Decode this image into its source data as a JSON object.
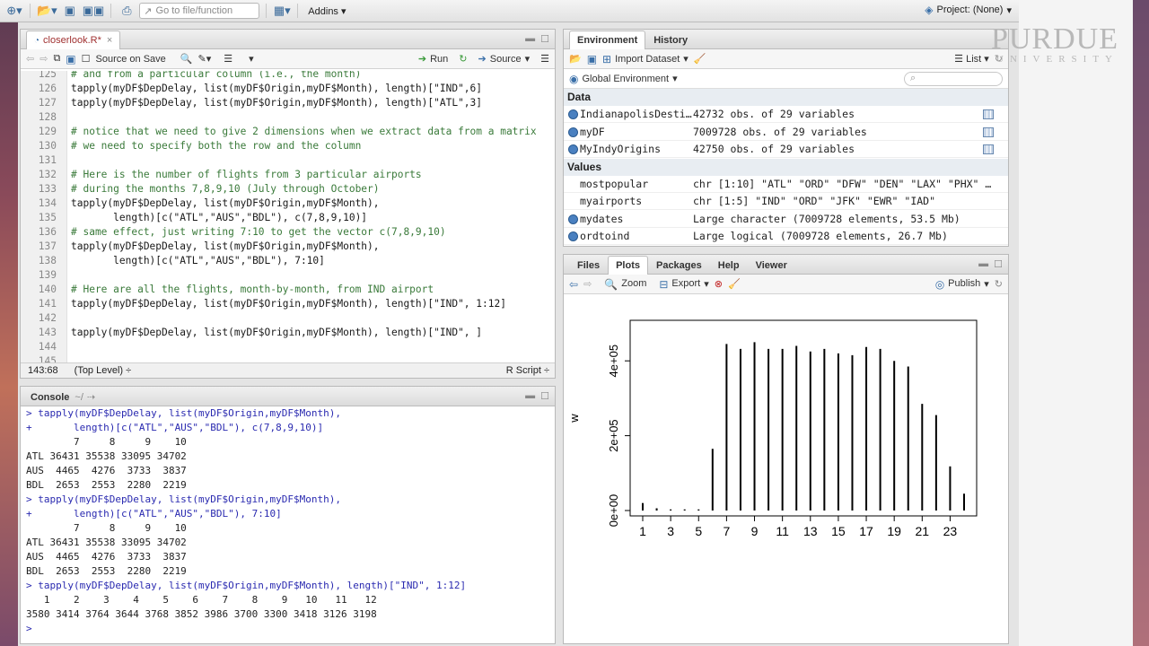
{
  "toolbar": {
    "goto_placeholder": "Go to file/function",
    "addins": "Addins",
    "project": "Project: (None)"
  },
  "branding": {
    "name": "PURDUE",
    "sub": "UNIVERSITY"
  },
  "editor": {
    "tab": "closerlook.R*",
    "source_on_save": "Source on Save",
    "run": "Run",
    "source": "Source",
    "lines": [
      {
        "n": "125",
        "t": "# and from a particular column (i.e., the month)",
        "c": true
      },
      {
        "n": "126",
        "t": "tapply(myDF$DepDelay, list(myDF$Origin,myDF$Month), length)[\"IND\",6]"
      },
      {
        "n": "127",
        "t": "tapply(myDF$DepDelay, list(myDF$Origin,myDF$Month), length)[\"ATL\",3]"
      },
      {
        "n": "128",
        "t": ""
      },
      {
        "n": "129",
        "t": "# notice that we need to give 2 dimensions when we extract data from a matrix",
        "c": true
      },
      {
        "n": "130",
        "t": "# we need to specify both the row and the column",
        "c": true
      },
      {
        "n": "131",
        "t": ""
      },
      {
        "n": "132",
        "t": "# Here is the number of flights from 3 particular airports",
        "c": true
      },
      {
        "n": "133",
        "t": "# during the months 7,8,9,10 (July through October)",
        "c": true
      },
      {
        "n": "134",
        "t": "tapply(myDF$DepDelay, list(myDF$Origin,myDF$Month),"
      },
      {
        "n": "135",
        "t": "       length)[c(\"ATL\",\"AUS\",\"BDL\"), c(7,8,9,10)]"
      },
      {
        "n": "136",
        "t": "# same effect, just writing 7:10 to get the vector c(7,8,9,10)",
        "c": true
      },
      {
        "n": "137",
        "t": "tapply(myDF$DepDelay, list(myDF$Origin,myDF$Month),"
      },
      {
        "n": "138",
        "t": "       length)[c(\"ATL\",\"AUS\",\"BDL\"), 7:10]"
      },
      {
        "n": "139",
        "t": ""
      },
      {
        "n": "140",
        "t": "# Here are all the flights, month-by-month, from IND airport",
        "c": true
      },
      {
        "n": "141",
        "t": "tapply(myDF$DepDelay, list(myDF$Origin,myDF$Month), length)[\"IND\", 1:12]"
      },
      {
        "n": "142",
        "t": ""
      },
      {
        "n": "143",
        "t": "tapply(myDF$DepDelay, list(myDF$Origin,myDF$Month), length)[\"IND\", ]"
      },
      {
        "n": "144",
        "t": ""
      },
      {
        "n": "145",
        "t": ""
      }
    ],
    "status_pos": "143:68",
    "status_scope": "(Top Level) ÷",
    "status_type": "R Script ÷"
  },
  "console": {
    "tab": "Console",
    "path": "~/",
    "lines": [
      {
        "t": "> tapply(myDF$DepDelay, list(myDF$Origin,myDF$Month),",
        "cmd": true
      },
      {
        "t": "+       length)[c(\"ATL\",\"AUS\",\"BDL\"), c(7,8,9,10)]",
        "cmd": true
      },
      {
        "t": "        7     8     9    10"
      },
      {
        "t": "ATL 36431 35538 33095 34702"
      },
      {
        "t": "AUS  4465  4276  3733  3837"
      },
      {
        "t": "BDL  2653  2553  2280  2219"
      },
      {
        "t": "> tapply(myDF$DepDelay, list(myDF$Origin,myDF$Month),",
        "cmd": true
      },
      {
        "t": "+       length)[c(\"ATL\",\"AUS\",\"BDL\"), 7:10]",
        "cmd": true
      },
      {
        "t": "        7     8     9    10"
      },
      {
        "t": "ATL 36431 35538 33095 34702"
      },
      {
        "t": "AUS  4465  4276  3733  3837"
      },
      {
        "t": "BDL  2653  2553  2280  2219"
      },
      {
        "t": "> tapply(myDF$DepDelay, list(myDF$Origin,myDF$Month), length)[\"IND\", 1:12]",
        "cmd": true
      },
      {
        "t": "   1    2    3    4    5    6    7    8    9   10   11   12"
      },
      {
        "t": "3580 3414 3764 3644 3768 3852 3986 3700 3300 3418 3126 3198"
      },
      {
        "t": ">",
        "cmd": true
      }
    ]
  },
  "environment": {
    "tabs": [
      "Environment",
      "History"
    ],
    "import": "Import Dataset",
    "view": "List",
    "scope": "Global Environment",
    "data_header": "Data",
    "values_header": "Values",
    "data": [
      {
        "name": "IndianapolisDesti…",
        "val": "42732 obs. of 29 variables"
      },
      {
        "name": "myDF",
        "val": "7009728 obs. of 29 variables"
      },
      {
        "name": "MyIndyOrigins",
        "val": "42750 obs. of 29 variables"
      }
    ],
    "values": [
      {
        "name": "mostpopular",
        "val": "chr [1:10] \"ATL\" \"ORD\" \"DFW\" \"DEN\" \"LAX\" \"PHX\" …",
        "icon": false
      },
      {
        "name": "myairports",
        "val": "chr [1:5] \"IND\" \"ORD\" \"JFK\" \"EWR\" \"IAD\"",
        "icon": false
      },
      {
        "name": "mydates",
        "val": "Large character (7009728 elements, 53.5 Mb)",
        "icon": true
      },
      {
        "name": "ordtoind",
        "val": "Large logical (7009728 elements, 26.7 Mb)",
        "icon": true
      }
    ]
  },
  "plots": {
    "tabs": [
      "Files",
      "Plots",
      "Packages",
      "Help",
      "Viewer"
    ],
    "zoom": "Zoom",
    "export": "Export",
    "publish": "Publish"
  },
  "chart_data": {
    "type": "bar",
    "ylabel": "w",
    "x": [
      1,
      2,
      3,
      4,
      5,
      6,
      7,
      8,
      9,
      10,
      11,
      12,
      13,
      14,
      15,
      16,
      17,
      18,
      19,
      20,
      21,
      22,
      23,
      24
    ],
    "values": [
      20000,
      6000,
      3000,
      3000,
      3000,
      165000,
      445000,
      432000,
      450000,
      432000,
      432000,
      440000,
      425000,
      432000,
      420000,
      415000,
      437000,
      432000,
      400000,
      385000,
      285000,
      255000,
      118000,
      45000
    ],
    "xticks": [
      "1",
      "3",
      "5",
      "7",
      "9",
      "11",
      "13",
      "15",
      "17",
      "19",
      "21",
      "23"
    ],
    "yticks": [
      "0e+00",
      "2e+05",
      "4e+05"
    ],
    "ylim": [
      0,
      470000
    ]
  }
}
